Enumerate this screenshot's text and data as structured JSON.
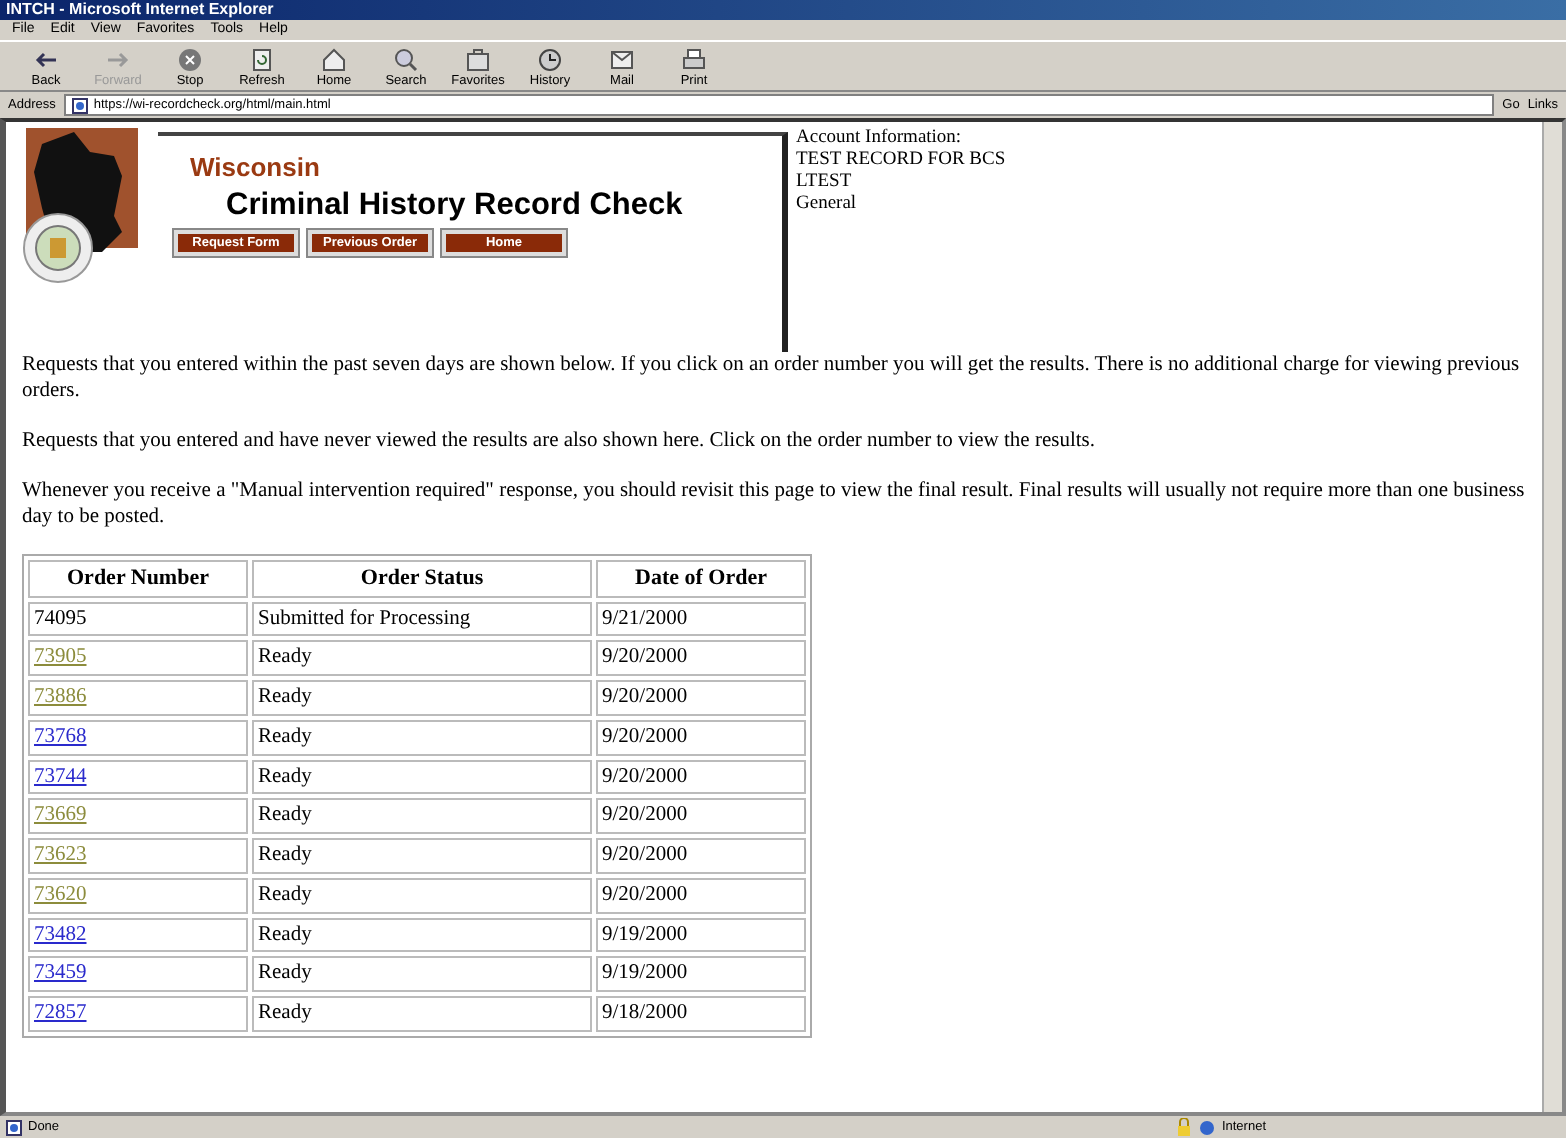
{
  "window": {
    "title": "INTCH - Microsoft Internet Explorer"
  },
  "menu": [
    "File",
    "Edit",
    "View",
    "Favorites",
    "Tools",
    "Help"
  ],
  "toolbar": [
    {
      "label": "Back",
      "disabled": false
    },
    {
      "label": "Forward",
      "disabled": true
    },
    {
      "label": "Stop",
      "disabled": false
    },
    {
      "label": "Refresh",
      "disabled": false
    },
    {
      "label": "Home",
      "disabled": false
    },
    {
      "label": "Search",
      "disabled": false
    },
    {
      "label": "Favorites",
      "disabled": false
    },
    {
      "label": "History",
      "disabled": false
    },
    {
      "label": "Mail",
      "disabled": false
    },
    {
      "label": "Print",
      "disabled": false
    }
  ],
  "address_bar": {
    "label": "Address",
    "value": "https://wi-recordcheck.org/html/main.html",
    "go": "Go",
    "links": "Links"
  },
  "header": {
    "state": "Wisconsin",
    "title": "Criminal History Record Check",
    "nav": [
      "Request Form",
      "Previous Order",
      "Home"
    ]
  },
  "account": [
    "Account Information:",
    "TEST RECORD FOR BCS",
    "LTEST",
    "General"
  ],
  "paragraphs": [
    "Requests that you entered within the past seven days are shown below. If you click on an order number you will get the results. There is no additional charge for viewing previous orders.",
    "Requests that you entered and have never viewed the results are also shown here. Click on the order number to view the results.",
    "Whenever you receive a \"Manual intervention required\" response, you should revisit this page to view the final result. Final results will usually not require more than one business day to be posted."
  ],
  "table": {
    "columns": [
      "Order Number",
      "Order Status",
      "Date of Order"
    ],
    "rows": [
      {
        "order": "74095",
        "kind": "text",
        "visited": false,
        "status": "Submitted for Processing",
        "date": "9/21/2000"
      },
      {
        "order": "73905",
        "kind": "link",
        "visited": true,
        "status": "Ready",
        "date": "9/20/2000"
      },
      {
        "order": "73886",
        "kind": "link",
        "visited": true,
        "status": "Ready",
        "date": "9/20/2000"
      },
      {
        "order": "73768",
        "kind": "link",
        "visited": false,
        "status": "Ready",
        "date": "9/20/2000"
      },
      {
        "order": "73744",
        "kind": "link",
        "visited": false,
        "status": "Ready",
        "date": "9/20/2000"
      },
      {
        "order": "73669",
        "kind": "link",
        "visited": true,
        "status": "Ready",
        "date": "9/20/2000"
      },
      {
        "order": "73623",
        "kind": "link",
        "visited": true,
        "status": "Ready",
        "date": "9/20/2000"
      },
      {
        "order": "73620",
        "kind": "link",
        "visited": true,
        "status": "Ready",
        "date": "9/20/2000"
      },
      {
        "order": "73482",
        "kind": "link",
        "visited": false,
        "status": "Ready",
        "date": "9/19/2000"
      },
      {
        "order": "73459",
        "kind": "link",
        "visited": false,
        "status": "Ready",
        "date": "9/19/2000"
      },
      {
        "order": "72857",
        "kind": "link",
        "visited": false,
        "status": "Ready",
        "date": "9/18/2000"
      }
    ]
  },
  "status_bar": {
    "text": "Done",
    "zone": "Internet"
  }
}
